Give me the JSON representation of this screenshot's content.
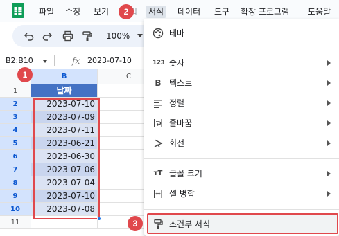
{
  "menu": {
    "items": [
      {
        "label": "파일"
      },
      {
        "label": "수정"
      },
      {
        "label": "보기"
      },
      {
        "label": "서식"
      },
      {
        "label": "데이터"
      },
      {
        "label": "도구"
      },
      {
        "label": "확장 프로그램"
      },
      {
        "label": "도움말"
      }
    ],
    "hidden_label": "삽입"
  },
  "toolbar": {
    "zoom": "100%"
  },
  "formula_bar": {
    "name_box": "B2:B10",
    "fx": "fx",
    "value": "2023-07-10"
  },
  "grid": {
    "columns": [
      "B",
      "C"
    ],
    "header_cell": "날짜",
    "rows": [
      {
        "num": "1"
      },
      {
        "num": "2",
        "value": "2023-07-10"
      },
      {
        "num": "3",
        "value": "2023-07-09"
      },
      {
        "num": "4",
        "value": "2023-07-11"
      },
      {
        "num": "5",
        "value": "2023-06-21"
      },
      {
        "num": "6",
        "value": "2023-06-30"
      },
      {
        "num": "7",
        "value": "2023-07-06"
      },
      {
        "num": "8",
        "value": "2023-07-04"
      },
      {
        "num": "9",
        "value": "2023-07-10"
      },
      {
        "num": "10",
        "value": "2023-07-08"
      },
      {
        "num": "11"
      }
    ]
  },
  "format_menu": {
    "theme": "테마",
    "number": "숫자",
    "text": "텍스트",
    "align": "정렬",
    "wrap": "줄바꿈",
    "rotate": "회전",
    "font_size": "글꼴 크기",
    "merge": "셀 병합",
    "conditional": "조건부 서식",
    "number_icon": "123",
    "text_icon": "B",
    "font_size_icon": "тT"
  },
  "badges": {
    "b1": "1",
    "b2": "2",
    "b3": "3"
  },
  "colors": {
    "header_fill": "#4472c4",
    "badge": "#e0484c",
    "selection": "#e0484c"
  }
}
